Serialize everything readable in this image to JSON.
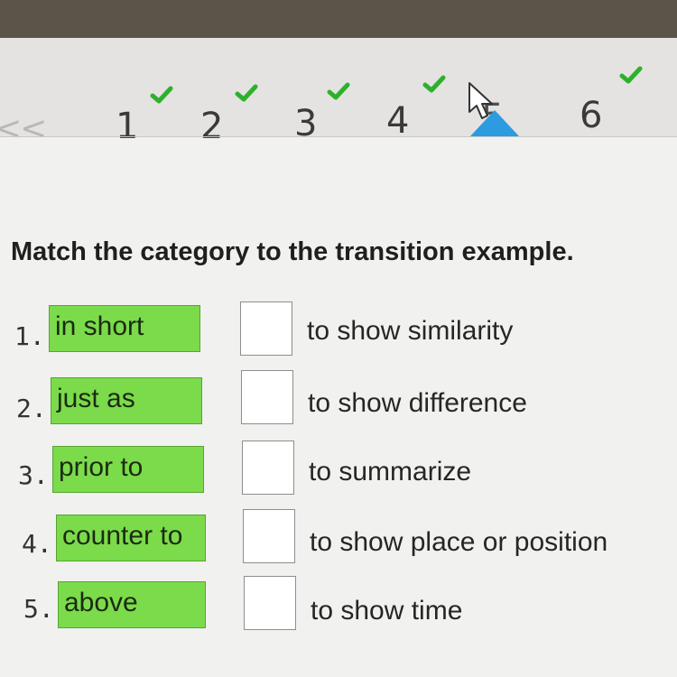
{
  "nav": {
    "prev_label": "<<",
    "questions": [
      {
        "label": "1",
        "completed": true
      },
      {
        "label": "2",
        "completed": true
      },
      {
        "label": "3",
        "completed": true
      },
      {
        "label": "4",
        "completed": true
      },
      {
        "label": "5",
        "completed": false,
        "active": true
      },
      {
        "label": "6",
        "completed": true
      }
    ],
    "check_color": "#2db12d",
    "active_color": "#2c9be0"
  },
  "question": {
    "prompt": "Match the category to the transition example.",
    "rows": [
      {
        "number": "1.",
        "term": "in short",
        "category": "to show similarity"
      },
      {
        "number": "2.",
        "term": "just as",
        "category": "to show difference"
      },
      {
        "number": "3.",
        "term": "prior to",
        "category": "to summarize"
      },
      {
        "number": "4.",
        "term": "counter to",
        "category": "to show place or position"
      },
      {
        "number": "5.",
        "term": "above",
        "category": "to show time"
      }
    ]
  },
  "colors": {
    "term_background": "#7bdb4b",
    "term_border": "#58a433"
  }
}
